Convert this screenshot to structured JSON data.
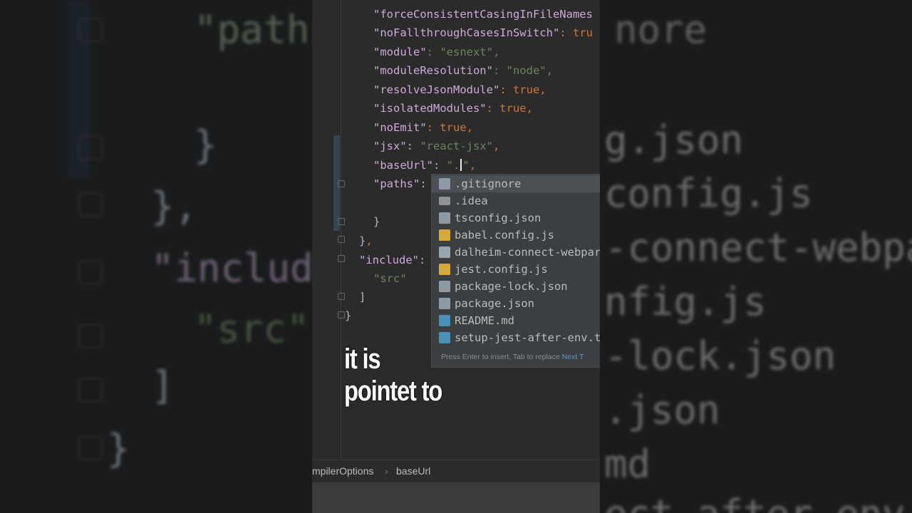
{
  "editor": {
    "code_lines": [
      {
        "key": "\"forceConsistentCasingInFileNames",
        "rest": ""
      },
      {
        "key": "\"noFallthroughCasesInSwitch\"",
        "rest": ": tru"
      },
      {
        "key": "\"module\"",
        "rest": ": \"esnext\","
      },
      {
        "key": "\"moduleResolution\"",
        "rest": ": \"node\","
      },
      {
        "key": "\"resolveJsonModule\"",
        "rest": ": true,"
      },
      {
        "key": "\"isolatedModules\"",
        "rest": ": true,"
      },
      {
        "key": "\"noEmit\"",
        "rest": ": true,"
      },
      {
        "key": "\"jsx\"",
        "rest": ": \"react-jsx\","
      },
      {
        "key": "\"baseUrl\"",
        "rest": ": \".\","
      },
      {
        "key": "\"paths\"",
        "rest": ":"
      },
      {
        "key": "}",
        "rest": ""
      },
      {
        "key": "},",
        "rest": ""
      },
      {
        "key": "\"include\"",
        "rest": ":"
      },
      {
        "key": "\"src\"",
        "rest": ""
      },
      {
        "key": "]",
        "rest": ""
      },
      {
        "key": "}",
        "rest": ""
      }
    ],
    "jsx_key": "\"jsx\"",
    "jsx_colon": ": ",
    "jsx_value": "\"react-jsx\"",
    "jsx_comma": ",",
    "baseurl_key": "\"baseUrl\"",
    "baseurl_colon": ": ",
    "baseurl_open": "\".",
    "baseurl_close": "\"",
    "baseurl_comma": ",",
    "paths_key": "\"paths\"",
    "paths_colon": ":",
    "include_key": "\"include\"",
    "include_colon": ":",
    "src_value": "\"src\"",
    "close_brace_1": "}",
    "close_brace_2": "}",
    "close_bracket": "]",
    "close_brace_3": "}",
    "comma": ","
  },
  "completion": {
    "items": [
      {
        "label": ".gitignore",
        "icon": "file-icon"
      },
      {
        "label": ".idea",
        "icon": "folder-icon"
      },
      {
        "label": "tsconfig.json",
        "icon": "json-file-icon"
      },
      {
        "label": "babel.config.js",
        "icon": "js-file-icon"
      },
      {
        "label": "dalheim-connect-webpar",
        "icon": "generic-file-icon"
      },
      {
        "label": "jest.config.js",
        "icon": "js-file-icon"
      },
      {
        "label": "package-lock.json",
        "icon": "json-file-icon"
      },
      {
        "label": "package.json",
        "icon": "json-file-icon"
      },
      {
        "label": "README.md",
        "icon": "md-file-icon"
      },
      {
        "label": "setup-jest-after-env.t",
        "icon": "ts-file-icon"
      }
    ],
    "hint": "Press Enter to insert, Tab to replace",
    "hint_link": "Next T"
  },
  "breadcrumb": {
    "first": "mpilerOptions",
    "separator": "›",
    "second": "baseUrl"
  },
  "caption": {
    "line1": "it is",
    "line2": "pointet to"
  },
  "background_left": {
    "l1": "\"paths",
    "l2": "}",
    "l3": "},",
    "l4": "\"include",
    "l5": "\"src\"",
    "l6": "]",
    "l7": "}"
  },
  "background_right": {
    "l1": "nore",
    "l2": "g.json",
    "l3": "config.js",
    "l4": "-connect-webpa",
    "l5": "nfig.js",
    "l6": "-lock.json",
    "l7": ".json",
    "l8": "md",
    "l9": "ect after env"
  },
  "colors": {
    "editor_bg": "#2b2b2c",
    "key": "#cfa9d9",
    "string": "#6a8759",
    "keyword": "#cc7832",
    "popup_bg": "#3c3f41",
    "popup_selected": "#4b5055"
  }
}
